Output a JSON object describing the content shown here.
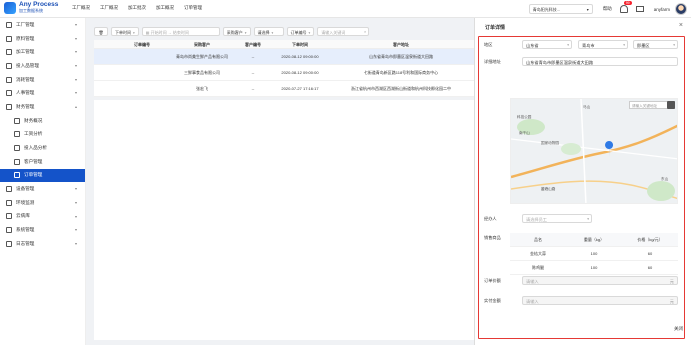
{
  "header": {
    "logo_title": "Any Process",
    "logo_sub": "加工数据系统",
    "nav": [
      "工厂概况",
      "工厂概况",
      "加工批次",
      "加工概况",
      "订单管理"
    ],
    "factory_select": "青岛阳光科技...",
    "user_label": "帮助",
    "notify_count": "99",
    "user_name": "anyfarm"
  },
  "sidebar": {
    "items": [
      {
        "label": "工厂管理",
        "sub": false
      },
      {
        "label": "原料管理",
        "sub": false
      },
      {
        "label": "加工管理",
        "sub": false
      },
      {
        "label": "投入品管理",
        "sub": false
      },
      {
        "label": "消耗管理",
        "sub": false
      },
      {
        "label": "人事管理",
        "sub": false
      },
      {
        "label": "财务管理",
        "sub": false
      },
      {
        "label": "财务概况",
        "sub": true
      },
      {
        "label": "工资分析",
        "sub": true
      },
      {
        "label": "投入品分析",
        "sub": true
      },
      {
        "label": "客户管理",
        "sub": true
      },
      {
        "label": "订单管理",
        "sub": true,
        "active": true
      },
      {
        "label": "设备管理",
        "sub": false
      },
      {
        "label": "环境监测",
        "sub": false
      },
      {
        "label": "云病库",
        "sub": false
      },
      {
        "label": "系统管理",
        "sub": false
      },
      {
        "label": "日志管理",
        "sub": false
      }
    ]
  },
  "toolbar": {
    "time_type": "下单时间",
    "start_ph": "开始时间",
    "end_ph": "结束时间",
    "customer": "采购客户",
    "batch": "请选择",
    "order_no": "订单编号",
    "search_ph": "请输入关键词"
  },
  "table": {
    "headers": [
      "",
      "订单编号",
      "采购客户",
      "客户编号",
      "下单时间",
      "客户地址"
    ],
    "rows": [
      {
        "no": "",
        "customer": "青岛市尚美生鲜产品有限公司",
        "code": "--",
        "time": "2020-08-12 09:00:00",
        "addr": "山东省青岛市即墨区温泉街道大田路"
      },
      {
        "no": "",
        "customer": "三鲜事食品有限公司",
        "code": "--",
        "time": "2020-08-12 09:00:00",
        "addr": "七街道青岛新区路118号利和国际商务中心"
      },
      {
        "no": "",
        "customer": "张宏飞",
        "code": "--",
        "time": "2020-07-27 17:16:17",
        "addr": "浙江省杭州市西湖区西湖街山街道和杭州科技孵化园二中"
      }
    ]
  },
  "drawer": {
    "title": "订单详情",
    "region_label": "地区",
    "province": "山东省",
    "city": "青岛市",
    "district": "即墨区",
    "address_label": "详细地址",
    "address": "山东省青岛市即墨区温泉街道大田路",
    "map_search_ph": "请输入关键地址",
    "map_labels": [
      "马山",
      "科技公园",
      "国家动物园",
      "南干山",
      "鳌峰山路",
      "东山"
    ],
    "operator_label": "经办人",
    "operator_ph": "请选择员工",
    "goods_label": "销售商品",
    "goods_headers": [
      "品名",
      "重量（kg）",
      "价格（kg/元）"
    ],
    "goods_rows": [
      {
        "name": "金桔大蒜",
        "weight": "100",
        "price": "60"
      },
      {
        "name": "陈鸡腿",
        "weight": "100",
        "price": "60"
      }
    ],
    "amount_label": "订单价额",
    "amount_ph": "请输入",
    "amount_unit": "元",
    "paid_label": "实付金额",
    "paid_ph": "请输入",
    "paid_unit": "元",
    "close_label": "关闭"
  }
}
